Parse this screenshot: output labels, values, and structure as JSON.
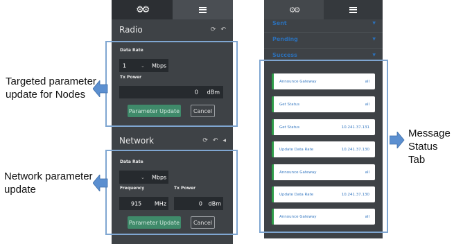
{
  "annotations": {
    "targeted_line1": "Targeted parameter",
    "targeted_line2": "update for Nodes",
    "network_line1": "Network parameter",
    "network_line2": "update",
    "message_line1": "Message",
    "message_line2": "Status Tab"
  },
  "left_panel": {
    "radio": {
      "title": "Radio",
      "data_rate_label": "Data Rate",
      "data_rate_value": "1",
      "data_rate_unit": "Mbps",
      "tx_power_label": "Tx Power",
      "tx_power_value": "0",
      "tx_power_unit": "dBm",
      "update_button": "Parameter Update",
      "cancel_button": "Cancel"
    },
    "network": {
      "title": "Network",
      "data_rate_label": "Data Rate",
      "data_rate_unit": "Mbps",
      "frequency_label": "Frequency",
      "frequency_value": "915",
      "frequency_unit": "MHz",
      "tx_power_label": "Tx Power",
      "tx_power_value": "0",
      "tx_power_unit": "dBm",
      "update_button": "Parameter Update",
      "cancel_button": "Cancel"
    }
  },
  "right_panel": {
    "sections": [
      "Sent",
      "Pending",
      "Success"
    ],
    "messages": [
      {
        "name": "Announce Gateway",
        "target": "all"
      },
      {
        "name": "Get Status",
        "target": "all"
      },
      {
        "name": "Get Status",
        "target": "10.241.37.131"
      },
      {
        "name": "Update Data Rate",
        "target": "10.241.37.130"
      },
      {
        "name": "Announce Gateway",
        "target": "all"
      },
      {
        "name": "Update Data Rate",
        "target": "10.241.37.130"
      },
      {
        "name": "Announce Gateway",
        "target": "all"
      }
    ]
  },
  "colors": {
    "panel_bg": "#3e4246",
    "highlight": "#7fa6d1",
    "arrow": "#5b8fd0",
    "accent_green": "#3f8a6a",
    "link_blue": "#3477c0"
  }
}
